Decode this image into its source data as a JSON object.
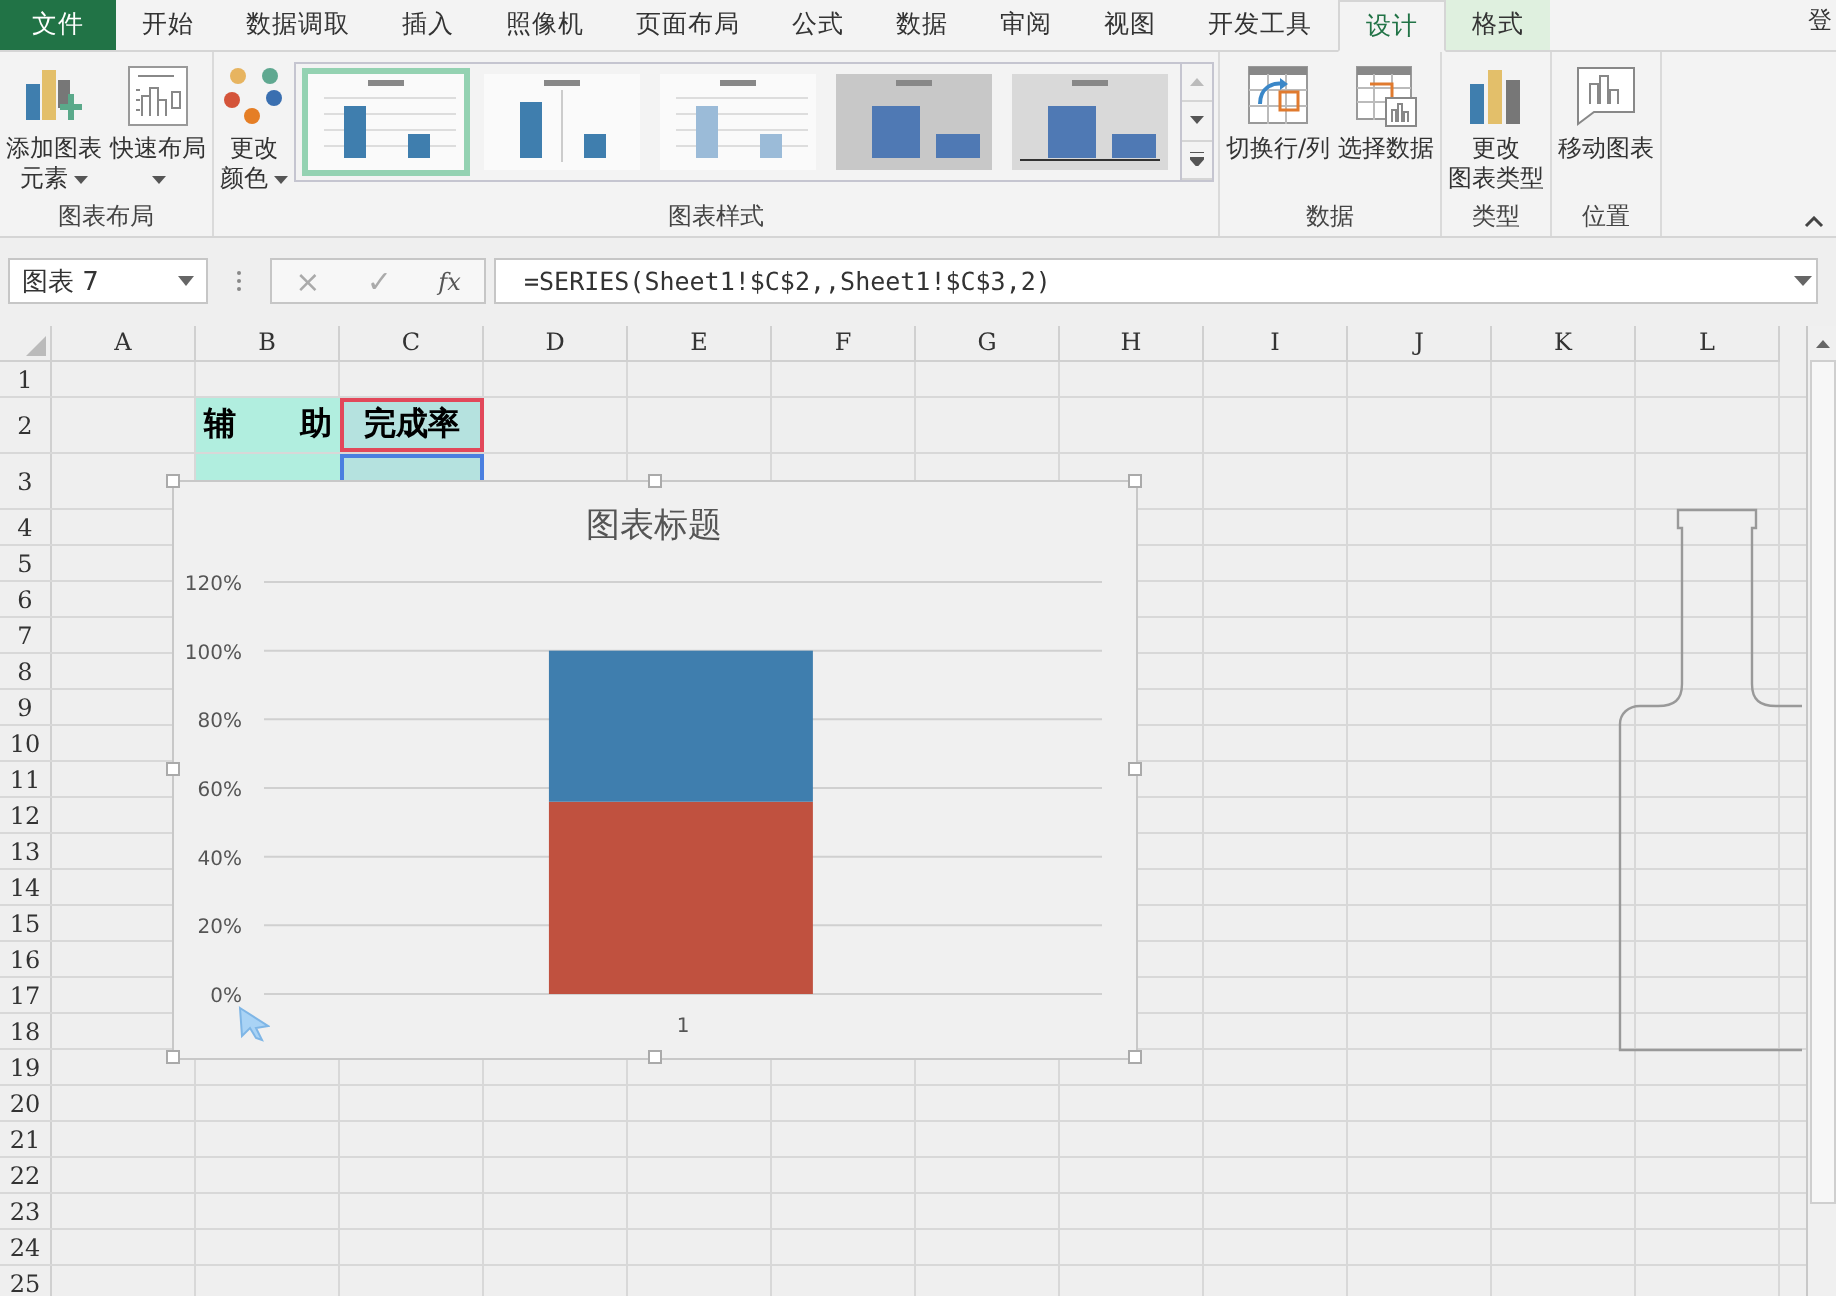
{
  "tabs": [
    {
      "label": "文件",
      "selected": false,
      "kind": "file"
    },
    {
      "label": "开始",
      "selected": false,
      "kind": "normal"
    },
    {
      "label": "数据调取",
      "selected": false,
      "kind": "normal"
    },
    {
      "label": "插入",
      "selected": false,
      "kind": "normal"
    },
    {
      "label": "照像机",
      "selected": false,
      "kind": "normal"
    },
    {
      "label": "页面布局",
      "selected": false,
      "kind": "normal"
    },
    {
      "label": "公式",
      "selected": false,
      "kind": "normal"
    },
    {
      "label": "数据",
      "selected": false,
      "kind": "normal"
    },
    {
      "label": "审阅",
      "selected": false,
      "kind": "normal"
    },
    {
      "label": "视图",
      "selected": false,
      "kind": "normal"
    },
    {
      "label": "开发工具",
      "selected": false,
      "kind": "normal"
    },
    {
      "label": "设计",
      "selected": true,
      "kind": "contextual"
    },
    {
      "label": "格式",
      "selected": false,
      "kind": "contextual"
    }
  ],
  "account": "登",
  "ribbon_groups": [
    {
      "label": "图表布局",
      "buttons": [
        {
          "lines": [
            "添加图表",
            "元素"
          ],
          "dropdown": true,
          "kind": "elements"
        },
        {
          "lines": [
            "快速布局"
          ],
          "dropdown": true,
          "kind": "layout"
        }
      ]
    },
    {
      "label": "图表样式",
      "buttons": [
        {
          "lines": [
            "更改",
            "颜色"
          ],
          "dropdown": true,
          "kind": "colors"
        }
      ],
      "gallery": [
        {
          "selected": true
        },
        {
          "selected": false
        },
        {
          "selected": false
        },
        {
          "selected": false
        },
        {
          "selected": false
        }
      ]
    },
    {
      "label": "数据",
      "buttons": [
        {
          "lines": [
            "切换行/列"
          ],
          "dropdown": false,
          "kind": "switch"
        },
        {
          "lines": [
            "选择数据"
          ],
          "dropdown": false,
          "kind": "select"
        }
      ]
    },
    {
      "label": "类型",
      "buttons": [
        {
          "lines": [
            "更改",
            "图表类型"
          ],
          "dropdown": false,
          "kind": "type"
        }
      ]
    },
    {
      "label": "位置",
      "buttons": [
        {
          "lines": [
            "移动图表"
          ],
          "dropdown": false,
          "kind": "move"
        }
      ]
    }
  ],
  "formula_bar": {
    "name_box": "图表 7",
    "cancel": "×",
    "enter": "✓",
    "function": "fx",
    "formula": "=SERIES(Sheet1!$C$2,,Sheet1!$C$3,2)"
  },
  "sheet": {
    "columns": [
      "A",
      "B",
      "C",
      "D",
      "E",
      "F",
      "G",
      "H",
      "I",
      "J",
      "K",
      "L"
    ],
    "rows": [
      {
        "label": "1"
      },
      {
        "label": "2",
        "cells": [
          {
            "kind": "empty"
          },
          {
            "kind": "text",
            "text": "辅　　助",
            "color": "#b1eedf"
          },
          {
            "kind": "name",
            "text": "完成率",
            "color": "#b5e2df"
          }
        ]
      },
      {
        "label": "3",
        "cells": [
          {
            "kind": "empty"
          },
          {
            "kind": "fill",
            "color": "#b1eedf"
          },
          {
            "kind": "values",
            "color": "#b5e2df"
          }
        ]
      },
      {
        "label": "4"
      },
      {
        "label": "5"
      },
      {
        "label": "6"
      },
      {
        "label": "7"
      },
      {
        "label": "8"
      },
      {
        "label": "9"
      },
      {
        "label": "10"
      },
      {
        "label": "11"
      },
      {
        "label": "12"
      },
      {
        "label": "13"
      },
      {
        "label": "14"
      },
      {
        "label": "15"
      },
      {
        "label": "16"
      },
      {
        "label": "17"
      },
      {
        "label": "18"
      },
      {
        "label": "19"
      },
      {
        "label": "20"
      },
      {
        "label": "21"
      },
      {
        "label": "22"
      },
      {
        "label": "23"
      },
      {
        "label": "24"
      },
      {
        "label": "25"
      }
    ]
  },
  "chart": {
    "chart_data": {
      "type": "bar",
      "title": "图表标题",
      "categories": [
        "1"
      ],
      "stacked": true,
      "grid": true,
      "series": [
        {
          "color": "#c0513f",
          "values": [
            0.56
          ]
        },
        {
          "color": "#3f7eae",
          "values": [
            0.44
          ]
        }
      ],
      "ylim": [
        0,
        1.2
      ],
      "yticks": [
        {
          "value": 0,
          "label": "0%"
        },
        {
          "value": 0.2,
          "label": "20%"
        },
        {
          "value": 0.4,
          "label": "40%"
        },
        {
          "value": 0.6,
          "label": "60%"
        },
        {
          "value": 0.8,
          "label": "80%"
        },
        {
          "value": 1.0,
          "label": "100%"
        },
        {
          "value": 1.2,
          "label": "120%"
        }
      ]
    }
  }
}
